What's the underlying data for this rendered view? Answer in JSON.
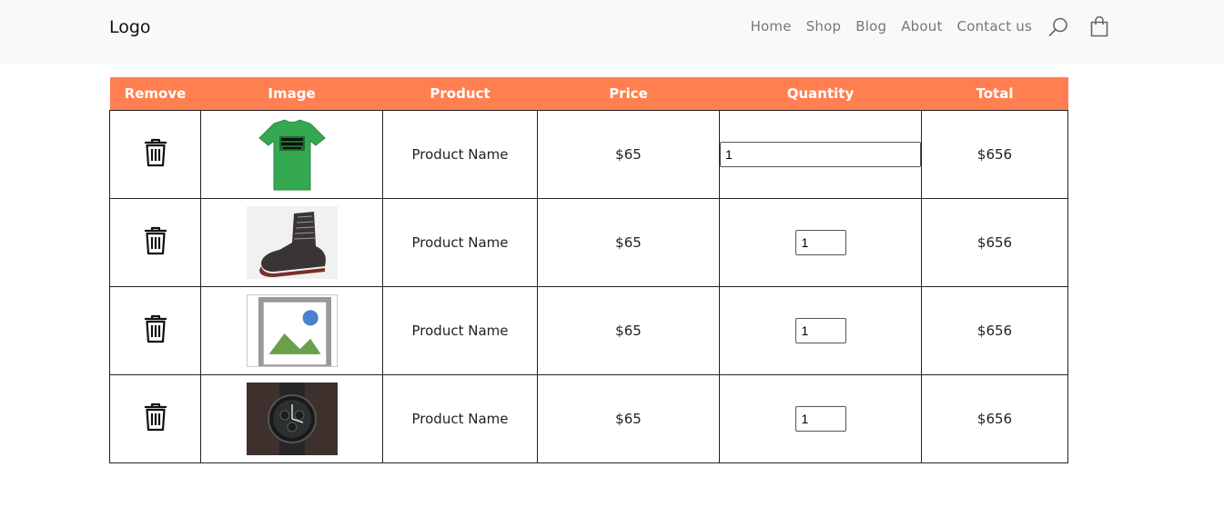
{
  "nav": {
    "logo": "Logo",
    "links": [
      "Home",
      "Shop",
      "Blog",
      "About",
      "Contact us"
    ],
    "icons": [
      "search-icon",
      "shopping-bag-icon"
    ]
  },
  "table": {
    "headers": [
      "Remove",
      "Image",
      "Product",
      "Price",
      "Quantity",
      "Total"
    ],
    "header_color": "#ff7f50",
    "rows": [
      {
        "image": "green-tshirt",
        "product": "Product Name",
        "price": "$65",
        "quantity": "1",
        "total": "$656"
      },
      {
        "image": "boot",
        "product": "Product Name",
        "price": "$65",
        "quantity": "1",
        "total": "$656"
      },
      {
        "image": "broken-image",
        "product": "Product Name",
        "price": "$65",
        "quantity": "1",
        "total": "$656"
      },
      {
        "image": "wristwatch",
        "product": "Product Name",
        "price": "$65",
        "quantity": "1",
        "total": "$656"
      }
    ]
  }
}
